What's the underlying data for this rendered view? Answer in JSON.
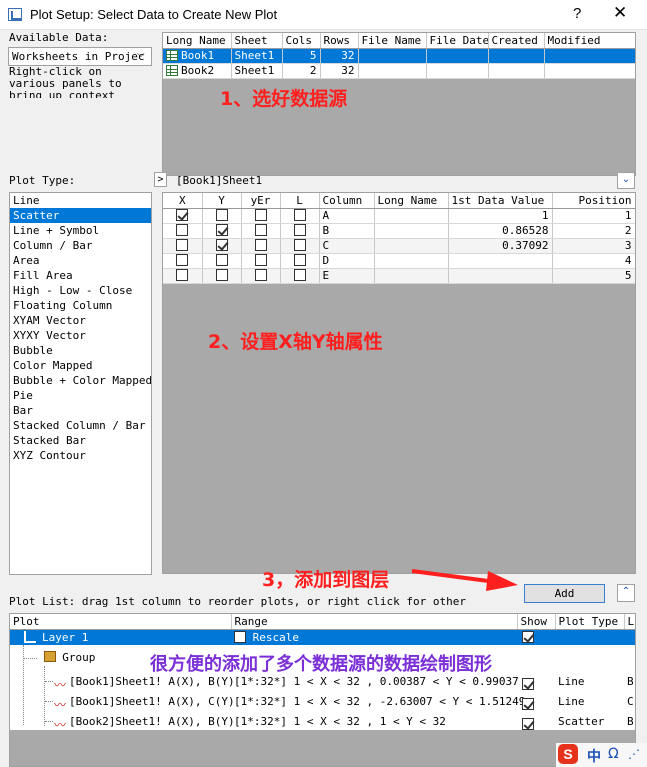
{
  "window": {
    "title": "Plot Setup: Select Data to Create New Plot",
    "help": "?",
    "close": "✕"
  },
  "available": {
    "label": "Available Data:",
    "select_value": "Worksheets in Projec",
    "hint": "Right-click on various panels to bring up context menus",
    "columns": [
      "Long Name",
      "Sheet",
      "Cols",
      "Rows",
      "File Name",
      "File Date",
      "Created",
      "Modified"
    ],
    "rows": [
      {
        "long_name": "Book1",
        "sheet": "Sheet1",
        "cols": "5",
        "rows": "32"
      },
      {
        "long_name": "Book2",
        "sheet": "Sheet1",
        "cols": "2",
        "rows": "32"
      }
    ]
  },
  "annotations": {
    "step1": "1、选好数据源",
    "step2": "2、设置X轴Y轴属性",
    "step3": "3，添加到图层",
    "summary": "很方便的添加了多个数据源的数据绘制图形"
  },
  "plot_type": {
    "label": "Plot Type:",
    "items": [
      "Line",
      "Scatter",
      "Line + Symbol",
      "Column / Bar",
      "Area",
      "Fill Area",
      "High - Low - Close",
      "Floating Column",
      "XYAM Vector",
      "XYXY Vector",
      "Bubble",
      "Color Mapped",
      "Bubble + Color Mapped",
      "Pie",
      "Bar",
      "Stacked Column / Bar",
      "Stacked Bar",
      "XYZ Contour"
    ],
    "selected": "Scatter"
  },
  "column_grid": {
    "expand_arrow": ">",
    "source": "[Book1]Sheet1",
    "columns": [
      "X",
      "Y",
      "yEr",
      "L",
      "Column",
      "Long Name",
      "1st Data Value",
      "Position"
    ],
    "rows": [
      {
        "x": true,
        "y": false,
        "yer": false,
        "l": false,
        "column": "A",
        "long_name": "",
        "first_value": "1",
        "position": "1"
      },
      {
        "x": false,
        "y": true,
        "yer": false,
        "l": false,
        "column": "B",
        "long_name": "",
        "first_value": "0.86528",
        "position": "2"
      },
      {
        "x": false,
        "y": true,
        "yer": false,
        "l": false,
        "column": "C",
        "long_name": "",
        "first_value": "0.37092",
        "position": "3"
      },
      {
        "x": false,
        "y": false,
        "yer": false,
        "l": false,
        "column": "D",
        "long_name": "",
        "first_value": "",
        "position": "4"
      },
      {
        "x": false,
        "y": false,
        "yer": false,
        "l": false,
        "column": "E",
        "long_name": "",
        "first_value": "",
        "position": "5"
      }
    ]
  },
  "add_button": "Add",
  "plot_list": {
    "label": "Plot List: drag 1st column to reorder plots, or right click for other",
    "columns": [
      "Plot",
      "Range",
      "Show",
      "Plot Type",
      "L"
    ],
    "layer": {
      "name": "Layer 1",
      "range": "Rescale",
      "rescale_checked": false,
      "show": true
    },
    "group": "Group",
    "plots": [
      {
        "name": "[Book1]Sheet1! A(X), B(Y)",
        "range": "[1*:32*]  1 < X < 32 , 0.00387 < Y < 0.99037",
        "show": true,
        "type": "Line",
        "l": "B"
      },
      {
        "name": "[Book1]Sheet1! A(X), C(Y)",
        "range": "[1*:32*]  1 < X < 32 , -2.63007 < Y < 1.51249",
        "show": true,
        "type": "Line",
        "l": "C"
      },
      {
        "name": "[Book2]Sheet1! A(X), B(Y)",
        "range": "[1*:32*]  1 < X < 32 , 1 < Y < 32",
        "show": true,
        "type": "Scatter",
        "l": "B"
      }
    ]
  },
  "ime": {
    "logo": "S",
    "lang": "中",
    "punct": "Ω"
  },
  "colors": {
    "selection": "#0078d7",
    "annotation_red": "#ff1f1f",
    "annotation_purple": "#7b2fd6",
    "gray_area": "#a9a9a9"
  }
}
